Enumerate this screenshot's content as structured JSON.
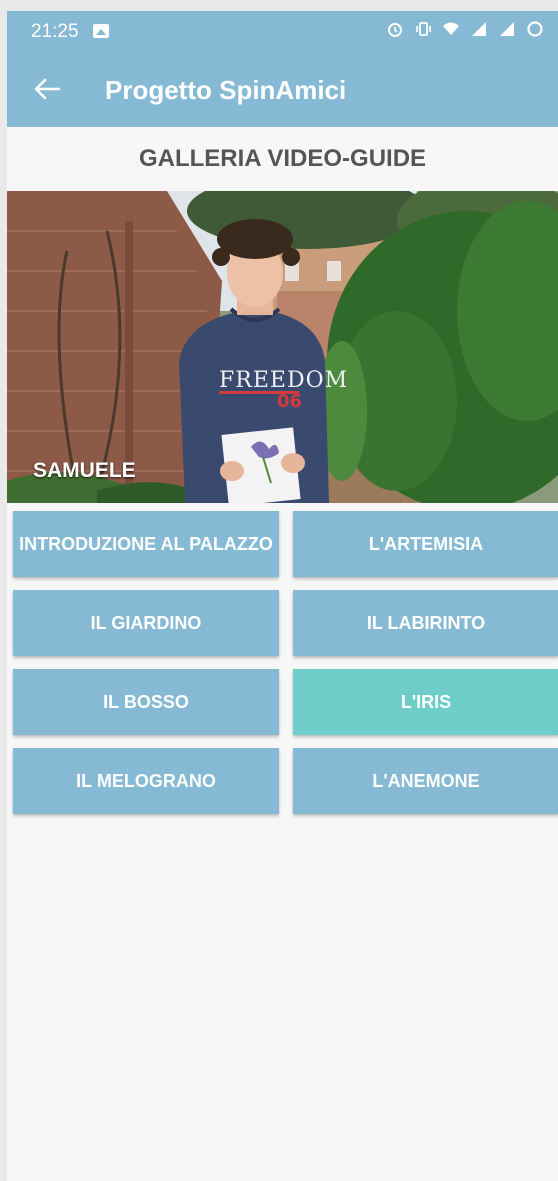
{
  "status": {
    "time": "21:25",
    "icons": [
      "image-icon",
      "alarm-icon",
      "vibrate-icon",
      "wifi-icon",
      "signal-icon",
      "signal-icon",
      "circle-icon"
    ]
  },
  "appbar": {
    "title": "Progetto SpinAmici",
    "back_icon": "arrow-left-icon"
  },
  "gallery": {
    "title": "GALLERIA VIDEO-GUIDE"
  },
  "video": {
    "name": "SAMUELE",
    "sweatshirt_text": "FREEDOM"
  },
  "buttons": [
    {
      "label": "INTRODUZIONE AL PALAZZO"
    },
    {
      "label": "L'ARTEMISIA"
    },
    {
      "label": "IL GIARDINO"
    },
    {
      "label": "IL LABIRINTO"
    },
    {
      "label": "IL BOSSO"
    },
    {
      "label": "L'IRIS"
    },
    {
      "label": "IL MELOGRANO"
    },
    {
      "label": "L'ANEMONE"
    }
  ],
  "colors": {
    "accent": "#86bad4",
    "active": "#6fcdc9",
    "background": "#f7f7f7"
  }
}
